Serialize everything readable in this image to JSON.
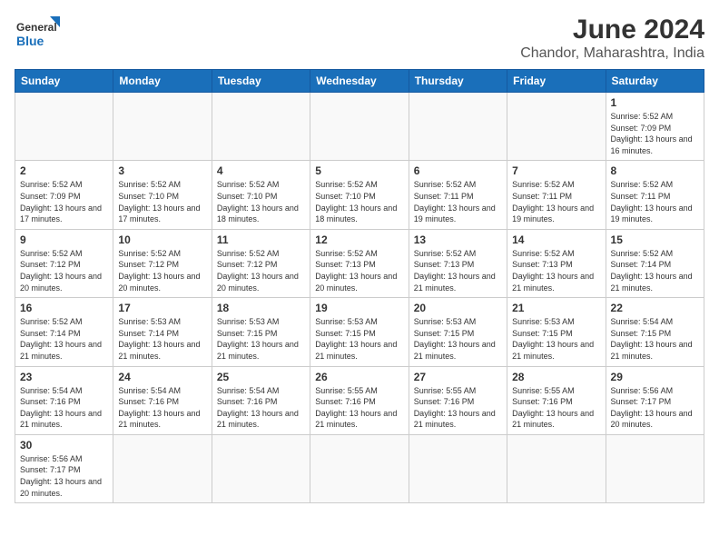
{
  "logo": {
    "text_general": "General",
    "text_blue": "Blue"
  },
  "title": "June 2024",
  "subtitle": "Chandor, Maharashtra, India",
  "days_of_week": [
    "Sunday",
    "Monday",
    "Tuesday",
    "Wednesday",
    "Thursday",
    "Friday",
    "Saturday"
  ],
  "weeks": [
    [
      {
        "day": null,
        "info": null
      },
      {
        "day": null,
        "info": null
      },
      {
        "day": null,
        "info": null
      },
      {
        "day": null,
        "info": null
      },
      {
        "day": null,
        "info": null
      },
      {
        "day": null,
        "info": null
      },
      {
        "day": "1",
        "info": "Sunrise: 5:52 AM\nSunset: 7:09 PM\nDaylight: 13 hours and 16 minutes."
      }
    ],
    [
      {
        "day": "2",
        "info": "Sunrise: 5:52 AM\nSunset: 7:09 PM\nDaylight: 13 hours and 17 minutes."
      },
      {
        "day": "3",
        "info": "Sunrise: 5:52 AM\nSunset: 7:10 PM\nDaylight: 13 hours and 17 minutes."
      },
      {
        "day": "4",
        "info": "Sunrise: 5:52 AM\nSunset: 7:10 PM\nDaylight: 13 hours and 18 minutes."
      },
      {
        "day": "5",
        "info": "Sunrise: 5:52 AM\nSunset: 7:10 PM\nDaylight: 13 hours and 18 minutes."
      },
      {
        "day": "6",
        "info": "Sunrise: 5:52 AM\nSunset: 7:11 PM\nDaylight: 13 hours and 19 minutes."
      },
      {
        "day": "7",
        "info": "Sunrise: 5:52 AM\nSunset: 7:11 PM\nDaylight: 13 hours and 19 minutes."
      },
      {
        "day": "8",
        "info": "Sunrise: 5:52 AM\nSunset: 7:11 PM\nDaylight: 13 hours and 19 minutes."
      }
    ],
    [
      {
        "day": "9",
        "info": "Sunrise: 5:52 AM\nSunset: 7:12 PM\nDaylight: 13 hours and 20 minutes."
      },
      {
        "day": "10",
        "info": "Sunrise: 5:52 AM\nSunset: 7:12 PM\nDaylight: 13 hours and 20 minutes."
      },
      {
        "day": "11",
        "info": "Sunrise: 5:52 AM\nSunset: 7:12 PM\nDaylight: 13 hours and 20 minutes."
      },
      {
        "day": "12",
        "info": "Sunrise: 5:52 AM\nSunset: 7:13 PM\nDaylight: 13 hours and 20 minutes."
      },
      {
        "day": "13",
        "info": "Sunrise: 5:52 AM\nSunset: 7:13 PM\nDaylight: 13 hours and 21 minutes."
      },
      {
        "day": "14",
        "info": "Sunrise: 5:52 AM\nSunset: 7:13 PM\nDaylight: 13 hours and 21 minutes."
      },
      {
        "day": "15",
        "info": "Sunrise: 5:52 AM\nSunset: 7:14 PM\nDaylight: 13 hours and 21 minutes."
      }
    ],
    [
      {
        "day": "16",
        "info": "Sunrise: 5:52 AM\nSunset: 7:14 PM\nDaylight: 13 hours and 21 minutes."
      },
      {
        "day": "17",
        "info": "Sunrise: 5:53 AM\nSunset: 7:14 PM\nDaylight: 13 hours and 21 minutes."
      },
      {
        "day": "18",
        "info": "Sunrise: 5:53 AM\nSunset: 7:15 PM\nDaylight: 13 hours and 21 minutes."
      },
      {
        "day": "19",
        "info": "Sunrise: 5:53 AM\nSunset: 7:15 PM\nDaylight: 13 hours and 21 minutes."
      },
      {
        "day": "20",
        "info": "Sunrise: 5:53 AM\nSunset: 7:15 PM\nDaylight: 13 hours and 21 minutes."
      },
      {
        "day": "21",
        "info": "Sunrise: 5:53 AM\nSunset: 7:15 PM\nDaylight: 13 hours and 21 minutes."
      },
      {
        "day": "22",
        "info": "Sunrise: 5:54 AM\nSunset: 7:15 PM\nDaylight: 13 hours and 21 minutes."
      }
    ],
    [
      {
        "day": "23",
        "info": "Sunrise: 5:54 AM\nSunset: 7:16 PM\nDaylight: 13 hours and 21 minutes."
      },
      {
        "day": "24",
        "info": "Sunrise: 5:54 AM\nSunset: 7:16 PM\nDaylight: 13 hours and 21 minutes."
      },
      {
        "day": "25",
        "info": "Sunrise: 5:54 AM\nSunset: 7:16 PM\nDaylight: 13 hours and 21 minutes."
      },
      {
        "day": "26",
        "info": "Sunrise: 5:55 AM\nSunset: 7:16 PM\nDaylight: 13 hours and 21 minutes."
      },
      {
        "day": "27",
        "info": "Sunrise: 5:55 AM\nSunset: 7:16 PM\nDaylight: 13 hours and 21 minutes."
      },
      {
        "day": "28",
        "info": "Sunrise: 5:55 AM\nSunset: 7:16 PM\nDaylight: 13 hours and 21 minutes."
      },
      {
        "day": "29",
        "info": "Sunrise: 5:56 AM\nSunset: 7:17 PM\nDaylight: 13 hours and 20 minutes."
      }
    ],
    [
      {
        "day": "30",
        "info": "Sunrise: 5:56 AM\nSunset: 7:17 PM\nDaylight: 13 hours and 20 minutes."
      },
      {
        "day": null,
        "info": null
      },
      {
        "day": null,
        "info": null
      },
      {
        "day": null,
        "info": null
      },
      {
        "day": null,
        "info": null
      },
      {
        "day": null,
        "info": null
      },
      {
        "day": null,
        "info": null
      }
    ]
  ]
}
